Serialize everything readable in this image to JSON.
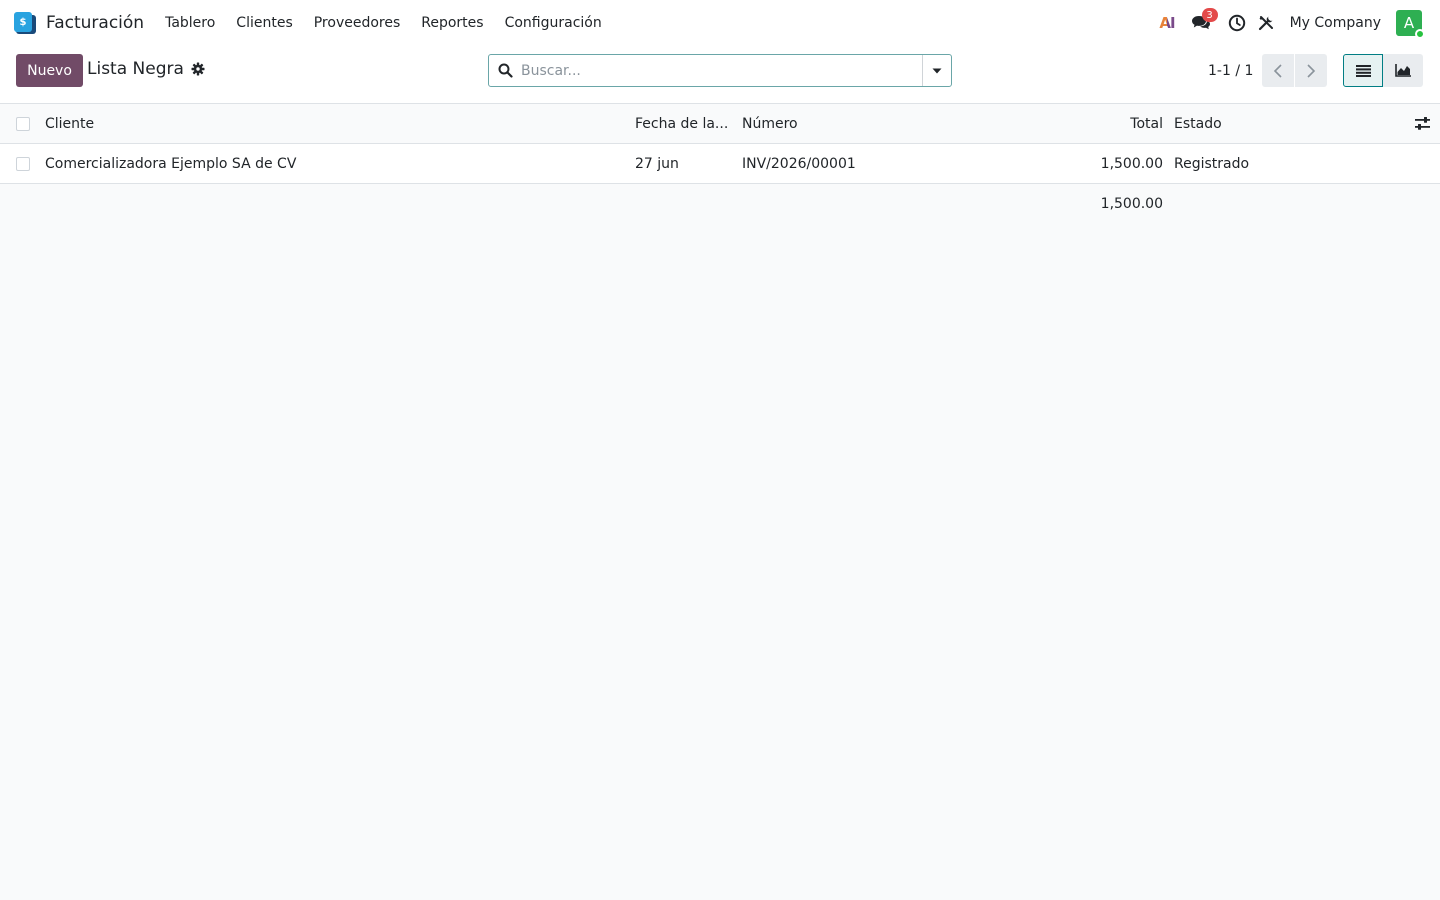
{
  "navbar": {
    "app_name": "Facturación",
    "app_icon_glyph": "$",
    "menu": [
      "Tablero",
      "Clientes",
      "Proveedores",
      "Reportes",
      "Configuración"
    ],
    "ai_label": "AI",
    "messages_count": "3",
    "company": "My Company",
    "avatar_initial": "A"
  },
  "control_panel": {
    "new_button": "Nuevo",
    "title": "Lista Negra",
    "search_placeholder": "Buscar...",
    "pager": "1-1 / 1"
  },
  "table": {
    "headers": {
      "client": "Cliente",
      "date": "Fecha de la...",
      "number": "Número",
      "total": "Total",
      "state": "Estado"
    },
    "rows": [
      {
        "client": "Comercializadora Ejemplo SA de CV",
        "date": "27 jun",
        "number": "INV/2026/00001",
        "total": "1,500.00",
        "state": "Registrado"
      }
    ],
    "footer_total": "1,500.00"
  },
  "colors": {
    "primary": "#714b67",
    "accent": "#017e84",
    "badge": "#e34a4a",
    "avatar": "#2eaf52"
  }
}
